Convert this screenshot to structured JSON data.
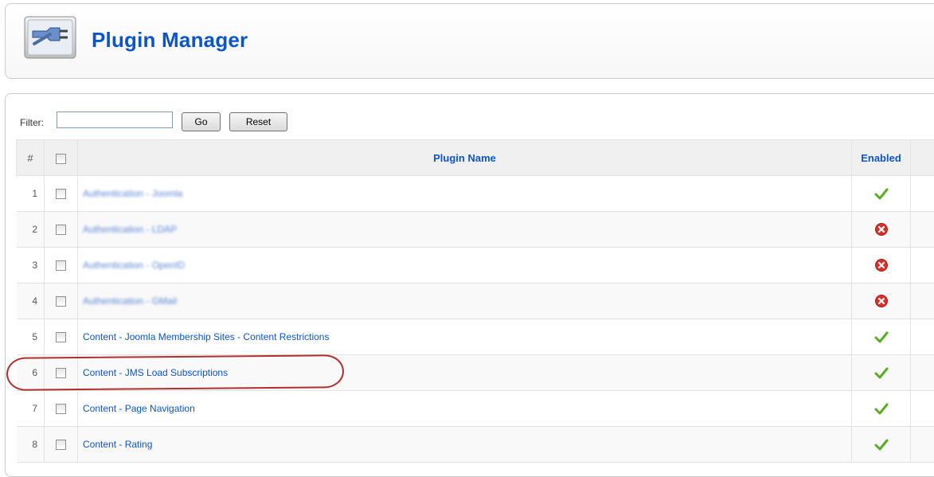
{
  "header": {
    "title": "Plugin Manager",
    "icon": "plugin-plug-icon"
  },
  "filter": {
    "label": "Filter:",
    "value": "",
    "go_label": "Go",
    "reset_label": "Reset"
  },
  "table": {
    "columns": {
      "number": "#",
      "name": "Plugin Name",
      "enabled": "Enabled"
    },
    "rows": [
      {
        "num": "1",
        "name": "Authentication - Joomla",
        "enabled": true,
        "blurred": true
      },
      {
        "num": "2",
        "name": "Authentication - LDAP",
        "enabled": false,
        "blurred": true
      },
      {
        "num": "3",
        "name": "Authentication - OpenID",
        "enabled": false,
        "blurred": true
      },
      {
        "num": "4",
        "name": "Authentication - GMail",
        "enabled": false,
        "blurred": true
      },
      {
        "num": "5",
        "name": "Content - Joomla Membership Sites - Content Restrictions",
        "enabled": true,
        "blurred": false
      },
      {
        "num": "6",
        "name": "Content - JMS Load Subscriptions",
        "enabled": true,
        "blurred": false
      },
      {
        "num": "7",
        "name": "Content - Page Navigation",
        "enabled": true,
        "blurred": false
      },
      {
        "num": "8",
        "name": "Content - Rating",
        "enabled": true,
        "blurred": false
      }
    ]
  },
  "colors": {
    "link": "#0b55c4",
    "enabled_check": "#5aab25",
    "disabled_x": "#d8312a",
    "highlight": "#b03030"
  }
}
